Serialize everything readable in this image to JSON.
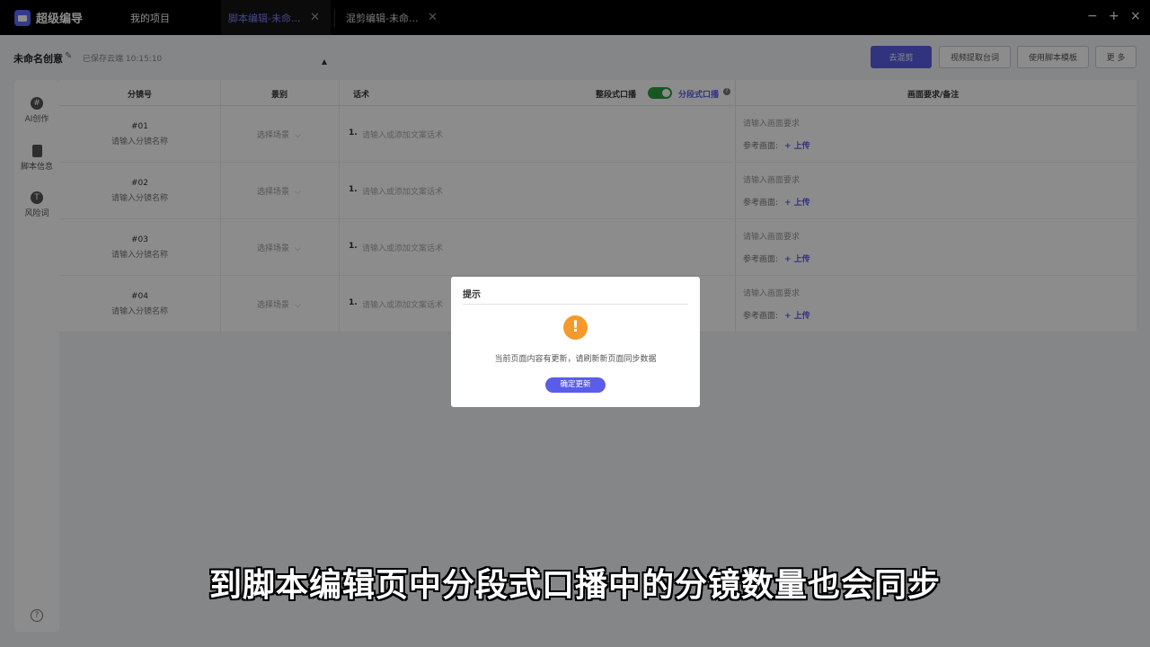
{
  "app": {
    "name": "超级编导"
  },
  "tabs": [
    {
      "label": "我的项目"
    },
    {
      "label": "脚本编辑-未命..."
    },
    {
      "label": "混剪编辑-未命..."
    }
  ],
  "window": {
    "minimize": "−",
    "maximize": "+",
    "close": "×"
  },
  "header": {
    "title": "未命名创意",
    "saved": "已保存云端 10:15:10",
    "buttons": {
      "mix": "去混剪",
      "extract": "视频提取台词",
      "template": "使用脚本模板",
      "more": "更 多"
    }
  },
  "sidebar": {
    "items": [
      {
        "label": "AI创作",
        "icon": "ai-icon"
      },
      {
        "label": "脚本信息",
        "icon": "document-icon"
      },
      {
        "label": "风险词",
        "icon": "risk-icon"
      }
    ],
    "help": "?"
  },
  "table": {
    "headers": {
      "shot": "分镜号",
      "scene": "景别",
      "script": "话术",
      "mode_off": "整段式口播",
      "mode_on": "分段式口播",
      "notes": "画面要求/备注"
    },
    "toggle_on": true,
    "rows": [
      {
        "id": "#01",
        "name": "请输入分镜名称",
        "scene": "选择场景",
        "line_no": "1.",
        "line": "请输入或添加文案话术",
        "req": "请输入画面要求",
        "ref": "参考画面:",
        "upload": "+ 上传"
      },
      {
        "id": "#02",
        "name": "请输入分镜名称",
        "scene": "选择场景",
        "line_no": "1.",
        "line": "请输入或添加文案话术",
        "req": "请输入画面要求",
        "ref": "参考画面:",
        "upload": "+ 上传"
      },
      {
        "id": "#03",
        "name": "请输入分镜名称",
        "scene": "选择场景",
        "line_no": "1.",
        "line": "请输入或添加文案话术",
        "req": "请输入画面要求",
        "ref": "参考画面:",
        "upload": "+ 上传"
      },
      {
        "id": "#04",
        "name": "请输入分镜名称",
        "scene": "选择场景",
        "line_no": "1.",
        "line": "请输入或添加文案话术",
        "req": "请输入画面要求",
        "ref": "参考画面:",
        "upload": "+ 上传"
      }
    ]
  },
  "dialog": {
    "title": "提示",
    "icon": "!",
    "message": "当前页面内容有更新，请刷新新页面同步数据",
    "button": "确定更新"
  },
  "subtitle": "到脚本编辑页中分段式口播中的分镜数量也会同步"
}
